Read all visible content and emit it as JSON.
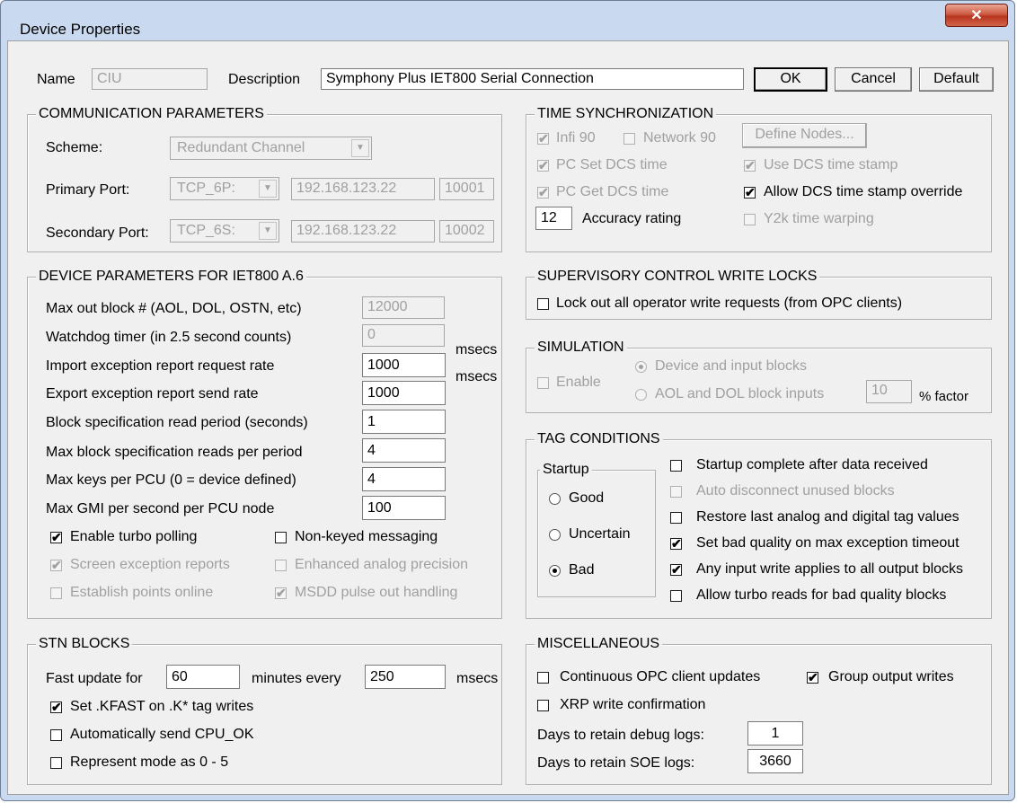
{
  "window": {
    "title": "Device Properties",
    "close_icon": "✕"
  },
  "header": {
    "name_label": "Name",
    "name_value": "CIU",
    "description_label": "Description",
    "description_value": "Symphony Plus IET800 Serial Connection",
    "ok": "OK",
    "cancel": "Cancel",
    "default": "Default"
  },
  "comm": {
    "title": "COMMUNICATION PARAMETERS",
    "scheme_label": "Scheme:",
    "scheme_value": "Redundant Channel",
    "primary_label": "Primary Port:",
    "primary_type": "TCP_6P:",
    "primary_ip": "192.168.123.22",
    "primary_port": "10001",
    "secondary_label": "Secondary Port:",
    "secondary_type": "TCP_6S:",
    "secondary_ip": "192.168.123.22",
    "secondary_port": "10002"
  },
  "time": {
    "title": "TIME SYNCHRONIZATION",
    "infi90": "Infi 90",
    "network90": "Network 90",
    "define_nodes": "Define Nodes...",
    "pc_set": "PC Set DCS time",
    "use_dcs": "Use DCS time stamp",
    "pc_get": "PC Get DCS time",
    "allow_override": "Allow DCS time stamp override",
    "accuracy_value": "12",
    "accuracy_label": "Accuracy rating",
    "y2k": "Y2k time warping"
  },
  "device": {
    "title": "DEVICE PARAMETERS FOR IET800 A.6",
    "rows": [
      {
        "label": "Max out block # (AOL, DOL, OSTN, etc)",
        "value": "12000"
      },
      {
        "label": "Watchdog timer (in 2.5 second counts)",
        "value": "0"
      },
      {
        "label": "Import exception report request rate",
        "value": "1000"
      },
      {
        "label": "Export exception report send rate",
        "value": "1000"
      },
      {
        "label": "Block specification read period (seconds)",
        "value": "1"
      },
      {
        "label": "Max block specification reads per period",
        "value": "4"
      },
      {
        "label": "Max keys per PCU (0 = device defined)",
        "value": "4"
      },
      {
        "label": "Max GMI per second per PCU node",
        "value": "100"
      }
    ],
    "msecs1": "msecs",
    "msecs2": "msecs",
    "enable_turbo": "Enable turbo polling",
    "non_keyed": "Non-keyed messaging",
    "screen_exception": "Screen exception reports",
    "enhanced_analog": "Enhanced analog precision",
    "establish_points": "Establish points online",
    "msdd_pulse": "MSDD pulse out handling"
  },
  "stn": {
    "title": "STN BLOCKS",
    "fast_label": "Fast update for",
    "fast_value": "60",
    "minutes_label": "minutes every",
    "msecs_value": "250",
    "msecs_label": "msecs",
    "kfast": "Set .KFAST on .K* tag writes",
    "cpu_ok": "Automatically send CPU_OK",
    "represent": "Represent mode as 0 - 5"
  },
  "supervisory": {
    "title": "SUPERVISORY CONTROL WRITE LOCKS",
    "lock": "Lock out all operator write requests (from OPC clients)"
  },
  "simulation": {
    "title": "SIMULATION",
    "enable": "Enable",
    "device_blocks": "Device and input blocks",
    "aol_dol": "AOL and DOL block inputs",
    "factor_value": "10",
    "factor_label": "% factor"
  },
  "tag": {
    "title": "TAG CONDITIONS",
    "startup_title": "Startup",
    "good": "Good",
    "uncertain": "Uncertain",
    "bad": "Bad",
    "startup_complete": "Startup complete after data received",
    "auto_disconnect": "Auto disconnect unused blocks",
    "restore_last": "Restore last analog and digital tag values",
    "set_bad": "Set bad quality on max exception timeout",
    "any_input": "Any input write applies to all output blocks",
    "allow_turbo": "Allow turbo reads for bad quality blocks"
  },
  "misc": {
    "title": "MISCELLANEOUS",
    "continuous": "Continuous OPC client updates",
    "group_output": "Group output writes",
    "xrp": "XRP write confirmation",
    "debug_label": "Days to retain debug logs:",
    "debug_value": "1",
    "soe_label": "Days to retain SOE logs:",
    "soe_value": "3660"
  },
  "glyphs": {
    "check": "✔",
    "dropdown_arrow": "▼"
  }
}
